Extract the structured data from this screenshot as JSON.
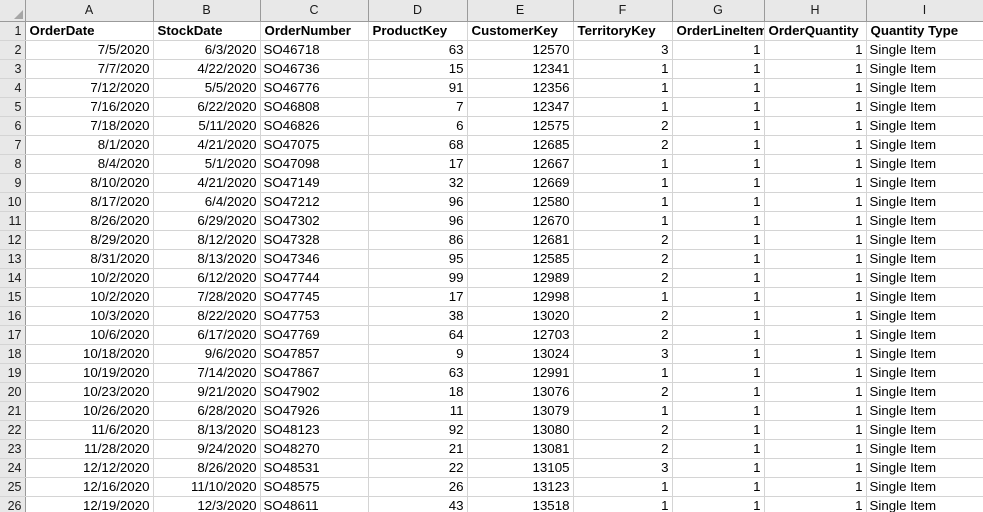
{
  "app": {
    "type": "spreadsheet",
    "select_all_icon": "select-all-triangle"
  },
  "columns": {
    "letters": [
      "A",
      "B",
      "C",
      "D",
      "E",
      "F",
      "G",
      "H",
      "I"
    ]
  },
  "headers": [
    "OrderDate",
    "StockDate",
    "OrderNumber",
    "ProductKey",
    "CustomerKey",
    "TerritoryKey",
    "OrderLineItem",
    "OrderQuantity",
    "Quantity Type"
  ],
  "row_numbers": [
    1,
    2,
    3,
    4,
    5,
    6,
    7,
    8,
    9,
    10,
    11,
    12,
    13,
    14,
    15,
    16,
    17,
    18,
    19,
    20,
    21,
    22,
    23,
    24,
    25,
    26
  ],
  "rows": [
    {
      "OrderDate": "7/5/2020",
      "StockDate": "6/3/2020",
      "OrderNumber": "SO46718",
      "ProductKey": "63",
      "CustomerKey": "12570",
      "TerritoryKey": "3",
      "OrderLineItem": "1",
      "OrderQuantity": "1",
      "QuantityType": "Single Item"
    },
    {
      "OrderDate": "7/7/2020",
      "StockDate": "4/22/2020",
      "OrderNumber": "SO46736",
      "ProductKey": "15",
      "CustomerKey": "12341",
      "TerritoryKey": "1",
      "OrderLineItem": "1",
      "OrderQuantity": "1",
      "QuantityType": "Single Item"
    },
    {
      "OrderDate": "7/12/2020",
      "StockDate": "5/5/2020",
      "OrderNumber": "SO46776",
      "ProductKey": "91",
      "CustomerKey": "12356",
      "TerritoryKey": "1",
      "OrderLineItem": "1",
      "OrderQuantity": "1",
      "QuantityType": "Single Item"
    },
    {
      "OrderDate": "7/16/2020",
      "StockDate": "6/22/2020",
      "OrderNumber": "SO46808",
      "ProductKey": "7",
      "CustomerKey": "12347",
      "TerritoryKey": "1",
      "OrderLineItem": "1",
      "OrderQuantity": "1",
      "QuantityType": "Single Item"
    },
    {
      "OrderDate": "7/18/2020",
      "StockDate": "5/11/2020",
      "OrderNumber": "SO46826",
      "ProductKey": "6",
      "CustomerKey": "12575",
      "TerritoryKey": "2",
      "OrderLineItem": "1",
      "OrderQuantity": "1",
      "QuantityType": "Single Item"
    },
    {
      "OrderDate": "8/1/2020",
      "StockDate": "4/21/2020",
      "OrderNumber": "SO47075",
      "ProductKey": "68",
      "CustomerKey": "12685",
      "TerritoryKey": "2",
      "OrderLineItem": "1",
      "OrderQuantity": "1",
      "QuantityType": "Single Item"
    },
    {
      "OrderDate": "8/4/2020",
      "StockDate": "5/1/2020",
      "OrderNumber": "SO47098",
      "ProductKey": "17",
      "CustomerKey": "12667",
      "TerritoryKey": "1",
      "OrderLineItem": "1",
      "OrderQuantity": "1",
      "QuantityType": "Single Item"
    },
    {
      "OrderDate": "8/10/2020",
      "StockDate": "4/21/2020",
      "OrderNumber": "SO47149",
      "ProductKey": "32",
      "CustomerKey": "12669",
      "TerritoryKey": "1",
      "OrderLineItem": "1",
      "OrderQuantity": "1",
      "QuantityType": "Single Item"
    },
    {
      "OrderDate": "8/17/2020",
      "StockDate": "6/4/2020",
      "OrderNumber": "SO47212",
      "ProductKey": "96",
      "CustomerKey": "12580",
      "TerritoryKey": "1",
      "OrderLineItem": "1",
      "OrderQuantity": "1",
      "QuantityType": "Single Item"
    },
    {
      "OrderDate": "8/26/2020",
      "StockDate": "6/29/2020",
      "OrderNumber": "SO47302",
      "ProductKey": "96",
      "CustomerKey": "12670",
      "TerritoryKey": "1",
      "OrderLineItem": "1",
      "OrderQuantity": "1",
      "QuantityType": "Single Item"
    },
    {
      "OrderDate": "8/29/2020",
      "StockDate": "8/12/2020",
      "OrderNumber": "SO47328",
      "ProductKey": "86",
      "CustomerKey": "12681",
      "TerritoryKey": "2",
      "OrderLineItem": "1",
      "OrderQuantity": "1",
      "QuantityType": "Single Item"
    },
    {
      "OrderDate": "8/31/2020",
      "StockDate": "8/13/2020",
      "OrderNumber": "SO47346",
      "ProductKey": "95",
      "CustomerKey": "12585",
      "TerritoryKey": "2",
      "OrderLineItem": "1",
      "OrderQuantity": "1",
      "QuantityType": "Single Item"
    },
    {
      "OrderDate": "10/2/2020",
      "StockDate": "6/12/2020",
      "OrderNumber": "SO47744",
      "ProductKey": "99",
      "CustomerKey": "12989",
      "TerritoryKey": "2",
      "OrderLineItem": "1",
      "OrderQuantity": "1",
      "QuantityType": "Single Item"
    },
    {
      "OrderDate": "10/2/2020",
      "StockDate": "7/28/2020",
      "OrderNumber": "SO47745",
      "ProductKey": "17",
      "CustomerKey": "12998",
      "TerritoryKey": "1",
      "OrderLineItem": "1",
      "OrderQuantity": "1",
      "QuantityType": "Single Item"
    },
    {
      "OrderDate": "10/3/2020",
      "StockDate": "8/22/2020",
      "OrderNumber": "SO47753",
      "ProductKey": "38",
      "CustomerKey": "13020",
      "TerritoryKey": "2",
      "OrderLineItem": "1",
      "OrderQuantity": "1",
      "QuantityType": "Single Item"
    },
    {
      "OrderDate": "10/6/2020",
      "StockDate": "6/17/2020",
      "OrderNumber": "SO47769",
      "ProductKey": "64",
      "CustomerKey": "12703",
      "TerritoryKey": "2",
      "OrderLineItem": "1",
      "OrderQuantity": "1",
      "QuantityType": "Single Item"
    },
    {
      "OrderDate": "10/18/2020",
      "StockDate": "9/6/2020",
      "OrderNumber": "SO47857",
      "ProductKey": "9",
      "CustomerKey": "13024",
      "TerritoryKey": "3",
      "OrderLineItem": "1",
      "OrderQuantity": "1",
      "QuantityType": "Single Item"
    },
    {
      "OrderDate": "10/19/2020",
      "StockDate": "7/14/2020",
      "OrderNumber": "SO47867",
      "ProductKey": "63",
      "CustomerKey": "12991",
      "TerritoryKey": "1",
      "OrderLineItem": "1",
      "OrderQuantity": "1",
      "QuantityType": "Single Item"
    },
    {
      "OrderDate": "10/23/2020",
      "StockDate": "9/21/2020",
      "OrderNumber": "SO47902",
      "ProductKey": "18",
      "CustomerKey": "13076",
      "TerritoryKey": "2",
      "OrderLineItem": "1",
      "OrderQuantity": "1",
      "QuantityType": "Single Item"
    },
    {
      "OrderDate": "10/26/2020",
      "StockDate": "6/28/2020",
      "OrderNumber": "SO47926",
      "ProductKey": "11",
      "CustomerKey": "13079",
      "TerritoryKey": "1",
      "OrderLineItem": "1",
      "OrderQuantity": "1",
      "QuantityType": "Single Item"
    },
    {
      "OrderDate": "11/6/2020",
      "StockDate": "8/13/2020",
      "OrderNumber": "SO48123",
      "ProductKey": "92",
      "CustomerKey": "13080",
      "TerritoryKey": "2",
      "OrderLineItem": "1",
      "OrderQuantity": "1",
      "QuantityType": "Single Item"
    },
    {
      "OrderDate": "11/28/2020",
      "StockDate": "9/24/2020",
      "OrderNumber": "SO48270",
      "ProductKey": "21",
      "CustomerKey": "13081",
      "TerritoryKey": "2",
      "OrderLineItem": "1",
      "OrderQuantity": "1",
      "QuantityType": "Single Item"
    },
    {
      "OrderDate": "12/12/2020",
      "StockDate": "8/26/2020",
      "OrderNumber": "SO48531",
      "ProductKey": "22",
      "CustomerKey": "13105",
      "TerritoryKey": "3",
      "OrderLineItem": "1",
      "OrderQuantity": "1",
      "QuantityType": "Single Item"
    },
    {
      "OrderDate": "12/16/2020",
      "StockDate": "11/10/2020",
      "OrderNumber": "SO48575",
      "ProductKey": "26",
      "CustomerKey": "13123",
      "TerritoryKey": "1",
      "OrderLineItem": "1",
      "OrderQuantity": "1",
      "QuantityType": "Single Item"
    },
    {
      "OrderDate": "12/19/2020",
      "StockDate": "12/3/2020",
      "OrderNumber": "SO48611",
      "ProductKey": "43",
      "CustomerKey": "13518",
      "TerritoryKey": "1",
      "OrderLineItem": "1",
      "OrderQuantity": "1",
      "QuantityType": "Single Item"
    }
  ],
  "colors": {
    "header_bg": "#e8e8e8",
    "gridline": "#d4d4d4",
    "header_border": "#9a9a9a",
    "text": "#000000",
    "cell_bg": "#ffffff"
  }
}
